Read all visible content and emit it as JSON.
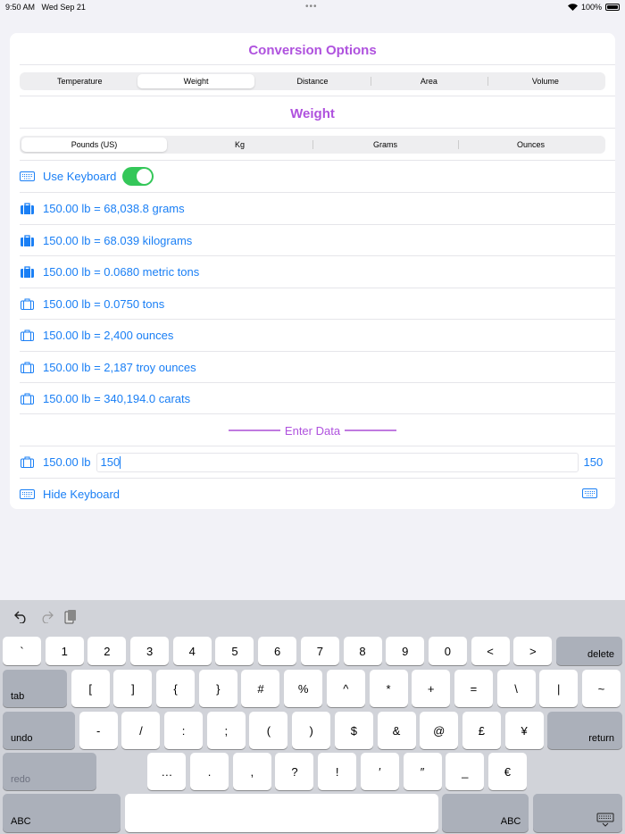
{
  "status": {
    "time": "9:50 AM",
    "date": "Wed Sep 21",
    "battery": "100%",
    "more_dots": "•••"
  },
  "colors": {
    "accent": "#af52de",
    "link": "#1a7ff5",
    "toggle": "#34c759"
  },
  "header": {
    "title": "Conversion Options"
  },
  "categories": [
    {
      "label": "Temperature"
    },
    {
      "label": "Weight",
      "selected": true
    },
    {
      "label": "Distance"
    },
    {
      "label": "Area"
    },
    {
      "label": "Volume"
    }
  ],
  "section_title": "Weight",
  "units": [
    {
      "label": "Pounds (US)",
      "selected": true
    },
    {
      "label": "Kg"
    },
    {
      "label": "Grams"
    },
    {
      "label": "Ounces"
    }
  ],
  "use_keyboard": {
    "label": "Use Keyboard",
    "on": true
  },
  "results": [
    {
      "text": "150.00 lb = 68,038.8 grams",
      "filled": true
    },
    {
      "text": "150.00 lb = 68.039 kilograms",
      "filled": true
    },
    {
      "text": "150.00 lb = 0.0680 metric tons",
      "filled": true
    },
    {
      "text": "150.00 lb = 0.0750 tons",
      "filled": false
    },
    {
      "text": "150.00 lb = 2,400 ounces",
      "filled": false
    },
    {
      "text": "150.00 lb = 2,187 troy ounces",
      "filled": false
    },
    {
      "text": "150.00 lb = 340,194.0 carats",
      "filled": false
    }
  ],
  "enter_data": {
    "label": "Enter Data",
    "prefix": "150.00 lb",
    "value": "150",
    "echo": "150"
  },
  "hide_keyboard": {
    "label": "Hide Keyboard"
  },
  "keyboard": {
    "row1": [
      "`",
      "1",
      "2",
      "3",
      "4",
      "5",
      "6",
      "7",
      "8",
      "9",
      "0",
      "<",
      ">"
    ],
    "delete": "delete",
    "tab": "tab",
    "row2": [
      "[",
      "]",
      "{",
      "}",
      "#",
      "%",
      "^",
      "*",
      "+",
      "=",
      "\\",
      "|",
      "~"
    ],
    "undo": "undo",
    "row3": [
      "-",
      "/",
      ":",
      ";",
      "(",
      ")",
      "$",
      "&",
      "@",
      "£",
      "¥"
    ],
    "return": "return",
    "redo": "redo",
    "row4": [
      "…",
      ".",
      ",",
      "?",
      "!",
      "′",
      "″",
      "_",
      "€"
    ],
    "abc_left": "ABC",
    "abc_right": "ABC"
  }
}
